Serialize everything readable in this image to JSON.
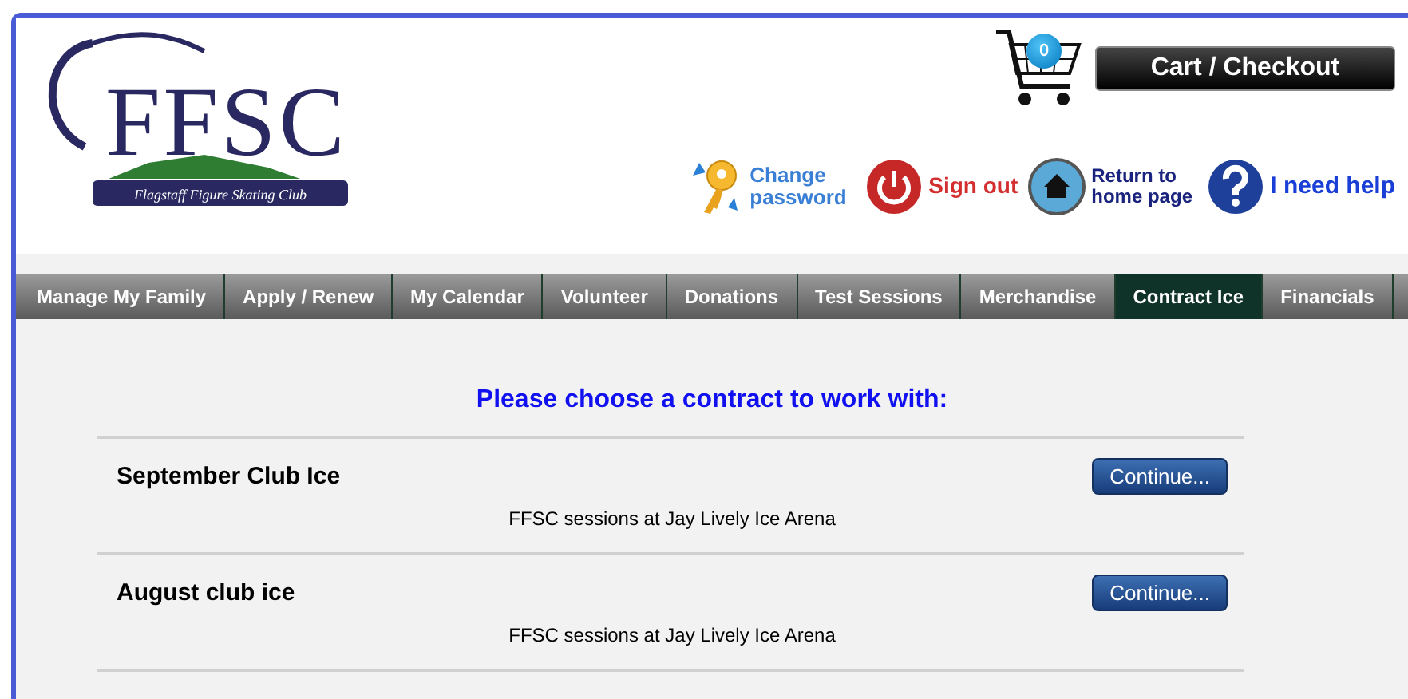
{
  "logo": {
    "letters": "FFSC",
    "tagline": "Flagstaff Figure Skating Club"
  },
  "cart": {
    "count": "0",
    "button": "Cart / Checkout"
  },
  "header_links": [
    {
      "kind": "password",
      "label": "Change password"
    },
    {
      "kind": "signout",
      "label": "Sign out"
    },
    {
      "kind": "home",
      "label": "Return to home page"
    },
    {
      "kind": "help",
      "label": "I need help"
    }
  ],
  "tabs": [
    {
      "label": "Manage My Family",
      "selected": false
    },
    {
      "label": "Apply / Renew",
      "selected": false
    },
    {
      "label": "My Calendar",
      "selected": false
    },
    {
      "label": "Volunteer",
      "selected": false
    },
    {
      "label": "Donations",
      "selected": false
    },
    {
      "label": "Test Sessions",
      "selected": false
    },
    {
      "label": "Merchandise",
      "selected": false
    },
    {
      "label": "Contract Ice",
      "selected": true
    },
    {
      "label": "Financials",
      "selected": false
    }
  ],
  "heading": "Please choose a contract to work with:",
  "contracts": [
    {
      "name": "September Club Ice",
      "button": "Continue...",
      "description": "FFSC sessions at Jay Lively Ice Arena"
    },
    {
      "name": "August club ice",
      "button": "Continue...",
      "description": "FFSC sessions at Jay Lively Ice Arena"
    }
  ]
}
